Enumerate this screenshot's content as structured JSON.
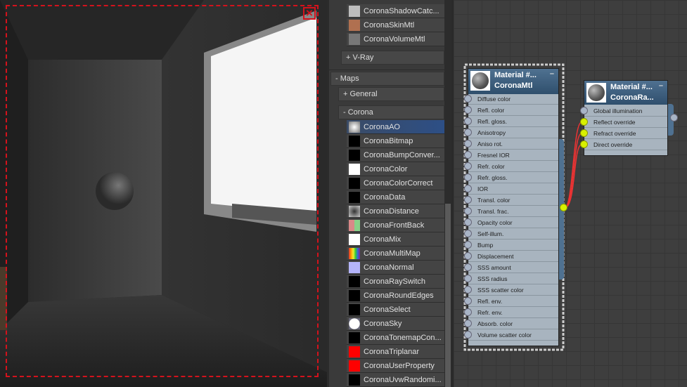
{
  "render": {
    "close_icon": "close-region-icon"
  },
  "browser": {
    "top_items": [
      {
        "label": "CoronaShadowCatc...",
        "swatch": "#bdbdbd"
      },
      {
        "label": "CoronaSkinMtl",
        "swatch": "#b07050"
      },
      {
        "label": "CoronaVolumeMtl",
        "swatch": "#777777"
      }
    ],
    "vray": "+ V-Ray",
    "maps": "- Maps",
    "general": "+ General",
    "corona": "- Corona",
    "maps_items": [
      {
        "label": "CoronaAO",
        "swatch": "radial-gradient(#fff,#777)"
      },
      {
        "label": "CoronaBitmap",
        "swatch": "#000"
      },
      {
        "label": "CoronaBumpConver...",
        "swatch": "#000"
      },
      {
        "label": "CoronaColor",
        "swatch": "#fff"
      },
      {
        "label": "CoronaColorCorrect",
        "swatch": "#000"
      },
      {
        "label": "CoronaData",
        "swatch": "#000"
      },
      {
        "label": "CoronaDistance",
        "swatch": "radial-gradient(#333,#ccc)"
      },
      {
        "label": "CoronaFrontBack",
        "swatch": "linear-gradient(90deg,#d98888 50%,#88d088 50%)"
      },
      {
        "label": "CoronaMix",
        "swatch": "#fff"
      },
      {
        "label": "CoronaMultiMap",
        "swatch": "linear-gradient(90deg,#d33,#f90,#ee3,#3c3,#36d,#828)"
      },
      {
        "label": "CoronaNormal",
        "swatch": "#b4b4fa"
      },
      {
        "label": "CoronaRaySwitch",
        "swatch": "#000"
      },
      {
        "label": "CoronaRoundEdges",
        "swatch": "#000"
      },
      {
        "label": "CoronaSelect",
        "swatch": "#000"
      },
      {
        "label": "CoronaSky",
        "swatch": "radial-gradient(circle,#fff 65%,#667 70%)"
      },
      {
        "label": "CoronaTonemapCon...",
        "swatch": "#000"
      },
      {
        "label": "CoronaTriplanar",
        "swatch": "#f00"
      },
      {
        "label": "CoronaUserProperty",
        "swatch": "#f00"
      },
      {
        "label": "CoronaUvwRandomi...",
        "swatch": "#000"
      }
    ],
    "selected": "CoronaAO"
  },
  "nodes": [
    {
      "title": "Material #...",
      "type": "CoronaMtl",
      "slots": [
        "Diffuse color",
        "Refl. color",
        "Refl. gloss.",
        "Anisotropy",
        "Aniso rot.",
        "Fresnel IOR",
        "Refr. color",
        "Refr. gloss.",
        "IOR",
        "Transl. color",
        "Transl. frac.",
        "Opacity color",
        "Self-illum.",
        "Bump",
        "Displacement",
        "SSS amount",
        "SSS radius",
        "SSS scatter color",
        "Refl. env.",
        "Refr. env.",
        "Absorb. color",
        "Volume scatter color"
      ]
    },
    {
      "title": "Material #...",
      "type": "CoronaRa...",
      "slots": [
        "Global illumination",
        "Reflect override",
        "Refract override",
        "Direct override"
      ],
      "connected": [
        1,
        2,
        3
      ]
    }
  ],
  "minimize": "–"
}
